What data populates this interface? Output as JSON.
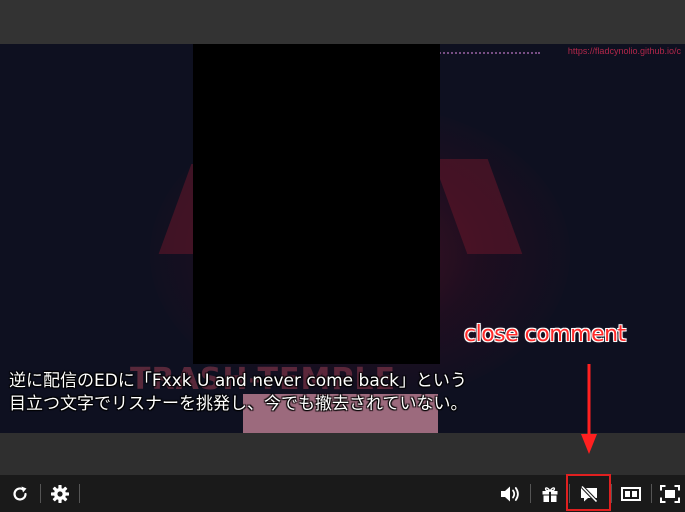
{
  "video": {
    "watermark": "https://fladcynolio.github.io/c",
    "background_title": "TRASH-TEMPLE",
    "subtitle_line1": "逆に配信のEDに「Fxxk U and never come back」という",
    "subtitle_line2": "目立つ文字でリスナーを挑発し、今でも撤去されていない。"
  },
  "annotation": {
    "label": "close comment",
    "color": "#ff2a2a"
  },
  "controls": {
    "reload_icon": "reload-icon",
    "settings_icon": "gear-icon",
    "volume_icon": "volume-icon",
    "gift_icon": "gift-icon",
    "comment_toggle_icon": "comment-off-icon",
    "theater_icon": "theater-mode-icon",
    "fullscreen_icon": "fullscreen-icon"
  },
  "colors": {
    "control_bar_bg": "#1a1a1a",
    "page_bg": "#2f2f2f",
    "highlight": "#e02020"
  }
}
